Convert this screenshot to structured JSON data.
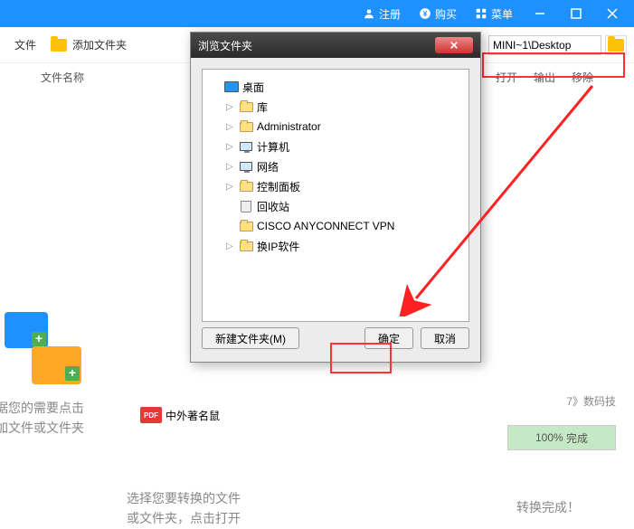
{
  "titlebar": {
    "register": "注册",
    "buy": "购买",
    "menu": "菜单"
  },
  "toolbar": {
    "add_folder": "添加文件夹",
    "path": "MINI~1\\Desktop"
  },
  "listhead": {
    "name": "文件名称",
    "open": "打开",
    "export": "输出",
    "remove": "移除"
  },
  "dialog": {
    "title": "浏览文件夹",
    "tree": {
      "desktop": "桌面",
      "lib": "库",
      "admin": "Administrator",
      "computer": "计算机",
      "network": "网络",
      "ctrlpanel": "控制面板",
      "recycle": "回收站",
      "cisco": "CISCO ANYCONNECT VPN",
      "ipswitch": "换IP软件"
    },
    "btn_new": "新建文件夹(M)",
    "btn_ok": "确定",
    "btn_cancel": "取消"
  },
  "bg": {
    "file_btn": "文件",
    "hint1": "据您的需要点击\n加文件或文件夹",
    "hint2": "选择您要转换的文件\n或文件夹，点击打开",
    "hint3": "转换完成！",
    "pdf_label": "PDF",
    "pdf_name": "中外著名鼠",
    "progress_pct": "100%",
    "progress_txt": "完成",
    "badge1": "7》数码技",
    "badge2": "7》"
  }
}
